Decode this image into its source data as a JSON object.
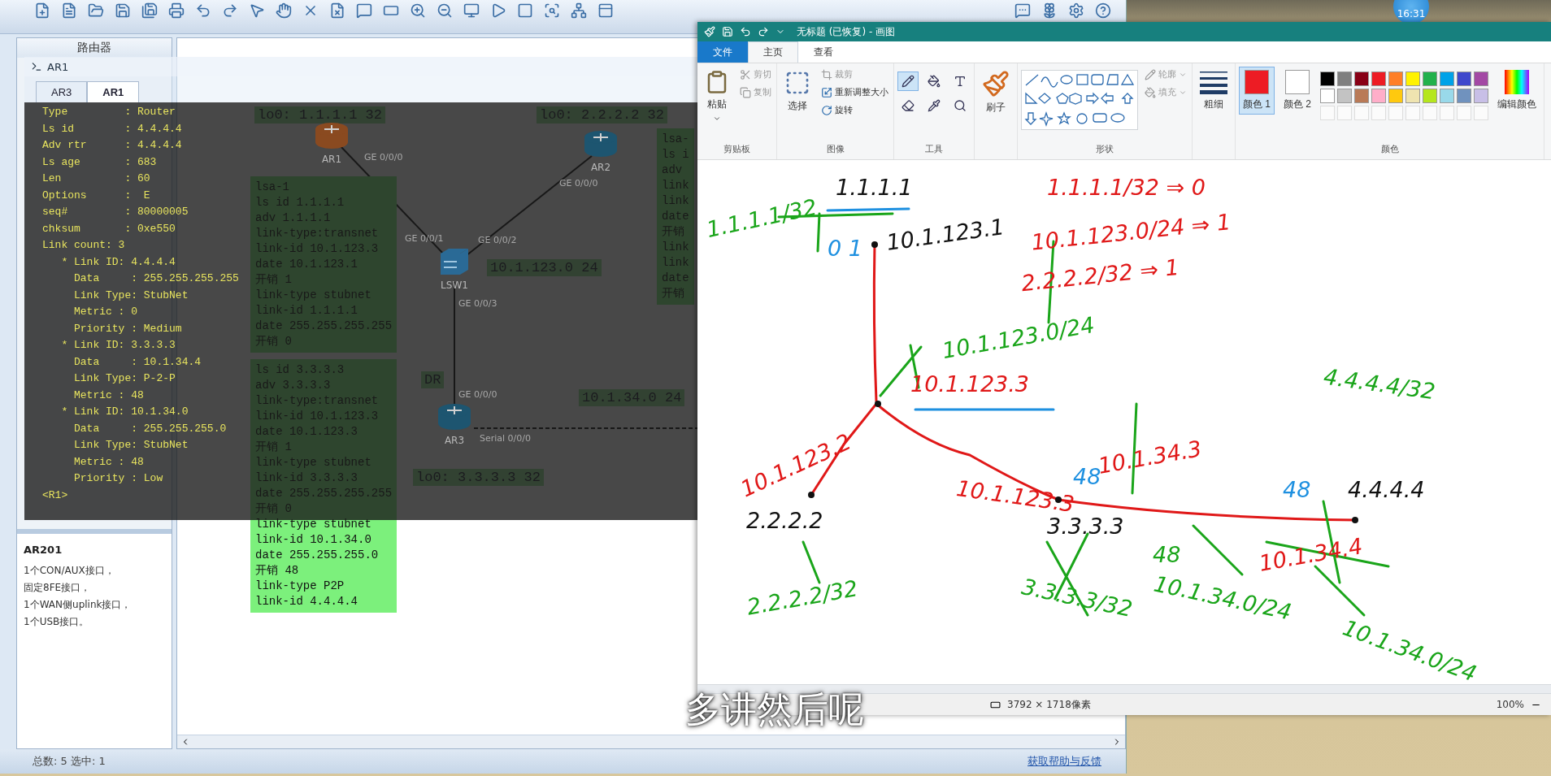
{
  "ensp": {
    "device_panel": {
      "title": "路由器"
    },
    "device_info": {
      "name": "AR201",
      "description": [
        "1个CON/AUX接口，",
        "固定8FE接口，",
        "1个WAN侧uplink接口，",
        "1个USB接口。"
      ]
    },
    "topology": {
      "nodes": [
        {
          "label": "AR1",
          "kind": "router",
          "color": "#8a4a20"
        },
        {
          "label": "AR2",
          "kind": "router",
          "color": "#1d5570"
        },
        {
          "label": "LSW1",
          "kind": "switch",
          "color": "#2a6a96"
        },
        {
          "label": "AR3",
          "kind": "router",
          "color": "#1d5570"
        }
      ],
      "ports": [
        "GE 0/0/0",
        "GE 0/0/0",
        "GE 0/0/1",
        "GE 0/0/2",
        "GE 0/0/3",
        "GE 0/0/0",
        "Serial 0/0/0"
      ],
      "labels": [
        "lo0: 1.1.1.1 32",
        "lo0: 2.2.2.2 32",
        "10.1.123.0 24",
        "DR",
        "10.1.34.0 24",
        "lo0: 3.3.3.3 32"
      ],
      "notes": [
        {
          "lines": [
            "lsa-1",
            "ls id 1.1.1.1",
            "adv 1.1.1.1",
            "link-type:transnet",
            "link-id 10.1.123.3",
            "date 10.1.123.1",
            "开销 1",
            "link-type stubnet",
            "link-id 1.1.1.1",
            "date 255.255.255.255",
            "开销 0"
          ]
        },
        {
          "lines": [
            "ls id 3.3.3.3",
            "adv 3.3.3.3",
            "link-type:transnet",
            "link-id 10.1.123.3",
            "date 10.1.123.3",
            "开销 1",
            "link-type stubnet",
            "link-id 3.3.3.3",
            "date 255.255.255.255",
            "开销 0",
            "link-type stubnet",
            "link-id 10.1.34.0",
            "date 255.255.255.0",
            "开销 48",
            "link-type P2P",
            "link-id 4.4.4.4"
          ]
        },
        {
          "lines": [
            "lsa-",
            "ls i",
            "adv",
            "link",
            "link",
            "date",
            "开销",
            "link",
            "link",
            "date",
            "开销"
          ]
        }
      ]
    },
    "status_bar": "总数: 5  选中: 1",
    "help_link": "获取帮助与反馈"
  },
  "terminal": {
    "title": "AR1",
    "tabs": [
      {
        "label": "AR3",
        "selected": false
      },
      {
        "label": "AR1",
        "selected": true
      }
    ],
    "lines": [
      "Type         : Router",
      "Ls id        : 4.4.4.4",
      "Adv rtr      : 4.4.4.4",
      "Ls age       : 683",
      "Len          : 60",
      "Options      :  E",
      "seq#         : 80000005",
      "chksum       : 0xe550",
      "Link count: 3",
      "   * Link ID: 4.4.4.4",
      "     Data     : 255.255.255.255",
      "     Link Type: StubNet",
      "     Metric : 0",
      "     Priority : Medium",
      "   * Link ID: 3.3.3.3",
      "     Data     : 10.1.34.4",
      "     Link Type: P-2-P",
      "     Metric : 48",
      "   * Link ID: 10.1.34.0",
      "     Data     : 255.255.255.0",
      "     Link Type: StubNet",
      "     Metric : 48",
      "     Priority : Low",
      "<R1>"
    ]
  },
  "paint": {
    "title": "无标题 (已恢复) - 画图",
    "tabs": [
      {
        "label": "文件",
        "kind": "file",
        "selected": false
      },
      {
        "label": "主页",
        "kind": "tab",
        "selected": true
      },
      {
        "label": "查看",
        "kind": "tab",
        "selected": false
      }
    ],
    "groups": [
      {
        "kind": "clipboard",
        "label": "剪贴板",
        "buttons": [
          {
            "label": "粘贴",
            "disabled": false
          },
          {
            "label": "剪切",
            "disabled": true
          },
          {
            "label": "复制",
            "disabled": true
          }
        ]
      },
      {
        "kind": "image",
        "label": "图像",
        "buttons": [
          {
            "label": "选择",
            "disabled": false
          },
          {
            "label": "裁剪",
            "disabled": true
          },
          {
            "label": "重新调整大小",
            "disabled": false
          },
          {
            "label": "旋转",
            "disabled": false
          }
        ]
      },
      {
        "kind": "tools",
        "label": "工具",
        "tools": [
          {
            "kind": "pencil",
            "selected": true
          },
          {
            "kind": "fill",
            "selected": false
          },
          {
            "kind": "text",
            "selected": false
          },
          {
            "kind": "eraser",
            "selected": false
          },
          {
            "kind": "picker",
            "selected": false
          },
          {
            "kind": "magnifier",
            "selected": false
          }
        ]
      },
      {
        "kind": "brushes",
        "buttons": [
          {
            "label": "刷子",
            "disabled": false
          }
        ]
      },
      {
        "kind": "shapes",
        "label": "形状",
        "buttons": [
          {
            "label": "轮廓",
            "disabled": true
          },
          {
            "label": "填充",
            "disabled": true
          }
        ]
      },
      {
        "kind": "size",
        "buttons": [
          {
            "label": "粗细",
            "disabled": false
          }
        ]
      },
      {
        "kind": "colors",
        "label": "颜色",
        "current": [
          {
            "label": "颜色 1",
            "color": "#ed1c24",
            "selected": true
          },
          {
            "label": "颜色 2",
            "color": "#ffffff",
            "selected": false
          }
        ],
        "palette": [
          {
            "color": "#000000"
          },
          {
            "color": "#7f7f7f"
          },
          {
            "color": "#880015"
          },
          {
            "color": "#ed1c24"
          },
          {
            "color": "#ff7f27"
          },
          {
            "color": "#fff200"
          },
          {
            "color": "#22b14c"
          },
          {
            "color": "#00a2e8"
          },
          {
            "color": "#3f48cc"
          },
          {
            "color": "#a349a4"
          },
          {
            "color": "#ffffff"
          },
          {
            "color": "#c3c3c3"
          },
          {
            "color": "#b97a57"
          },
          {
            "color": "#ffaec9"
          },
          {
            "color": "#ffc90e"
          },
          {
            "color": "#efe4b0"
          },
          {
            "color": "#b5e61d"
          },
          {
            "color": "#99d9ea"
          },
          {
            "color": "#7092be"
          },
          {
            "color": "#c8bfe7"
          }
        ],
        "edit_label": "编辑颜色"
      }
    ],
    "handwriting": [
      {
        "text": "1.1.1.1",
        "color": "#111111"
      },
      {
        "text": "1.1.1.1/32",
        "color": "#1aa51a"
      },
      {
        "text": "0 1",
        "color": "#1e90e0"
      },
      {
        "text": "10.1.123.1",
        "color": "#111111"
      },
      {
        "text": "1.1.1.1/32 ⇒ 0",
        "color": "#e01818"
      },
      {
        "text": "10.1.123.0/24 ⇒ 1",
        "color": "#e01818"
      },
      {
        "text": "2.2.2.2/32 ⇒ 1",
        "color": "#e01818"
      },
      {
        "text": "10.1.123.0/24",
        "color": "#1aa51a"
      },
      {
        "text": "10.1.123.3",
        "color": "#e01818"
      },
      {
        "text": "4.4.4.4/32",
        "color": "#1aa51a"
      },
      {
        "text": "10.1.123.2",
        "color": "#e01818"
      },
      {
        "text": "2.2.2.2",
        "color": "#111111"
      },
      {
        "text": "2.2.2.2/32",
        "color": "#1aa51a"
      },
      {
        "text": "10.1.123.3",
        "color": "#e01818"
      },
      {
        "text": "10.1.34.3",
        "color": "#e01818"
      },
      {
        "text": "48",
        "color": "#1e90e0"
      },
      {
        "text": "3.3.3.3",
        "color": "#111111"
      },
      {
        "text": "48",
        "color": "#1aa51a"
      },
      {
        "text": "3.3.3.3/32",
        "color": "#1aa51a"
      },
      {
        "text": "10.1.34.0/24",
        "color": "#1aa51a"
      },
      {
        "text": "48",
        "color": "#1e90e0"
      },
      {
        "text": "4.4.4.4",
        "color": "#111111"
      },
      {
        "text": "10.1.34.4",
        "color": "#e01818"
      },
      {
        "text": "10.1.34.0/24",
        "color": "#1aa51a"
      }
    ],
    "status": {
      "size": "3792 × 1718像素",
      "zoom": "100%"
    }
  },
  "clock": "16:31",
  "subtitle": "多讲然后呢"
}
